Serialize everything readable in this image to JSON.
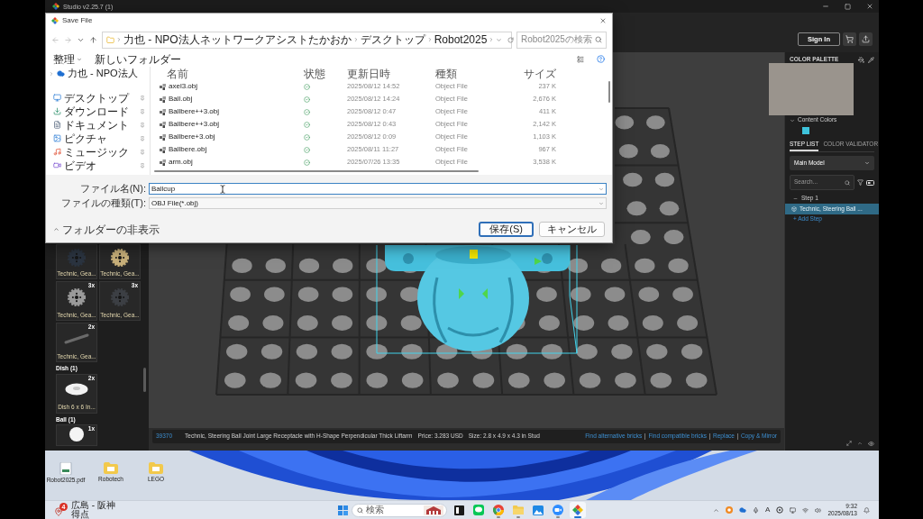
{
  "app": {
    "title": "Studio v2.25.7 (1)",
    "sign_in": "Sign In"
  },
  "save_dialog": {
    "title": "Save File",
    "nav_buttons": [
      {
        "kind": "back",
        "disabled": true
      },
      {
        "kind": "forward",
        "disabled": true
      },
      {
        "kind": "recent",
        "disabled": false
      },
      {
        "kind": "up",
        "disabled": false
      }
    ],
    "breadcrumb": [
      "力也 - NPO法人ネットワークアシストたかおか",
      "デスクトップ",
      "Robot2025"
    ],
    "search": {
      "placeholder": "Robot2025の検索"
    },
    "toolbar": {
      "organize": "整理",
      "new_folder": "新しいフォルダー"
    },
    "nav_root": {
      "label": "力也 - NPO法人",
      "expanded": false
    },
    "nav_items": [
      {
        "label": "デスクトップ",
        "kind": "desktop",
        "pinned": true
      },
      {
        "label": "ダウンロード",
        "kind": "download",
        "pinned": true
      },
      {
        "label": "ドキュメント",
        "kind": "documents",
        "pinned": true
      },
      {
        "label": "ピクチャ",
        "kind": "pictures",
        "pinned": true
      },
      {
        "label": "ミュージック",
        "kind": "music",
        "pinned": true
      },
      {
        "label": "ビデオ",
        "kind": "videos",
        "pinned": true
      }
    ],
    "columns": [
      "名前",
      "状態",
      "更新日時",
      "種類",
      "サイズ"
    ],
    "files": [
      {
        "name": "axel3.obj",
        "synced": true,
        "modified": "2025/08/12 14:52",
        "type": "Object File",
        "size": "237 K"
      },
      {
        "name": "Ball.obj",
        "synced": true,
        "modified": "2025/08/12 14:24",
        "type": "Object File",
        "size": "2,676 K"
      },
      {
        "name": "Ballbere++3.obj",
        "synced": true,
        "modified": "2025/08/12 0:47",
        "type": "Object File",
        "size": "411 K"
      },
      {
        "name": "Ballbere++3.obj",
        "synced": true,
        "modified": "2025/08/12 0:43",
        "type": "Object File",
        "size": "2,142 K"
      },
      {
        "name": "Ballbere+3.obj",
        "synced": true,
        "modified": "2025/08/12 0:09",
        "type": "Object File",
        "size": "1,103 K"
      },
      {
        "name": "Ballbere.obj",
        "synced": true,
        "modified": "2025/08/11 11:27",
        "type": "Object File",
        "size": "967 K"
      },
      {
        "name": "arm.obj",
        "synced": true,
        "modified": "2025/07/26 13:35",
        "type": "Object File",
        "size": "3,538 K"
      }
    ],
    "file_name": {
      "label": "ファイル名(N):",
      "value": "Ballcup",
      "focused": true
    },
    "file_type": {
      "label": "ファイルの種類(T):",
      "value": "OBJ File(*.obj)"
    },
    "hide_folders": {
      "label": "フォルダーの非表示"
    },
    "buttons": [
      {
        "label": "保存(S)",
        "default": true
      },
      {
        "label": "キャンセル",
        "default": false
      }
    ]
  },
  "parts_panel": {
    "sections": [
      {
        "tiles": [
          {
            "label": "Technic, Gea...",
            "kind": "gear",
            "color": "#2b3440"
          },
          {
            "label": "Technic, Gea...",
            "kind": "gear",
            "color": "#c8b07a"
          },
          {
            "label": "Technic, Gea...",
            "count": "3x",
            "kind": "gear",
            "color": "#9a9a9a"
          },
          {
            "label": "Technic, Gea...",
            "count": "3x",
            "kind": "gear",
            "color": "#3c3f44"
          },
          {
            "label": "Technic, Gea...",
            "count": "2x",
            "kind": "axle"
          }
        ]
      },
      {
        "heading": "Dish (1)",
        "tiles": [
          {
            "label": "Dish 6 x 6 In...",
            "count": "2x",
            "kind": "dish"
          }
        ]
      },
      {
        "heading": "Ball (1)",
        "tiles": [
          {
            "count": "1x",
            "kind": "ball"
          }
        ]
      }
    ]
  },
  "status_bar": {
    "part_id": "39370",
    "part_name": "Technic, Steering Ball Joint Large Receptacle with H-Shape Perpendicular Thick Liftarm",
    "price": "Price: 3.283 USD",
    "size": "Size: 2.8 x 4.9 x 4.3 in Stud",
    "links": [
      "Find alternative bricks",
      "Find compatible bricks",
      "Replace",
      "Copy & Mirror"
    ]
  },
  "right_panel": {
    "palette": {
      "title": "COLOR PALETTE",
      "section": {
        "label": "Content Colors",
        "expanded": true
      },
      "swatches": [
        {
          "color": "#3ec3dc"
        }
      ]
    },
    "tabs": [
      {
        "label": "STEP LIST",
        "selected": true
      },
      {
        "label": "COLOR VALIDATOR",
        "selected": false
      }
    ],
    "model_select": {
      "value": "Main Model"
    },
    "search": {
      "placeholder": "Search..."
    },
    "steps": [
      {
        "label": "Step 1",
        "expanded": true,
        "children": [
          {
            "label": "Technic, Steering Ball ...",
            "selected": true
          }
        ]
      }
    ],
    "add_step": "+ Add Step"
  },
  "desktop": {
    "icons": [
      {
        "label": "Robot2025.pdf",
        "kind": "pdf"
      },
      {
        "label": "Robotech",
        "kind": "folder"
      },
      {
        "label": "LEGO",
        "kind": "folder"
      }
    ]
  },
  "taskbar": {
    "news": {
      "badge": "4",
      "lines": [
        "広島 - 阪神",
        "得点"
      ]
    },
    "search": {
      "placeholder": "検索"
    },
    "apps": [
      {
        "kind": "task_view",
        "running": false,
        "selected": false
      },
      {
        "kind": "chat",
        "running": false,
        "selected": false
      },
      {
        "kind": "browser",
        "running": true,
        "selected": false
      },
      {
        "kind": "files",
        "running": true,
        "selected": false
      },
      {
        "kind": "gallery",
        "running": false,
        "selected": false
      },
      {
        "kind": "video_call",
        "running": true,
        "selected": false
      },
      {
        "kind": "studio",
        "running": true,
        "selected": true
      }
    ],
    "ime": "A",
    "clock": {
      "time": "9:32",
      "date": "2025/08/13"
    }
  }
}
